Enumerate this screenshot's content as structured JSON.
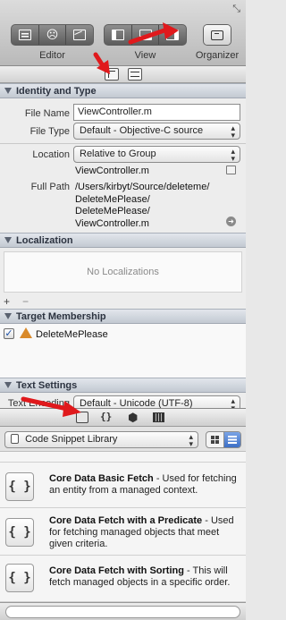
{
  "toolbar": {
    "editor_label": "Editor",
    "view_label": "View",
    "organizer_label": "Organizer"
  },
  "identity": {
    "title": "Identity and Type",
    "file_name_label": "File Name",
    "file_name_value": "ViewController.m",
    "file_type_label": "File Type",
    "file_type_value": "Default - Objective-C source",
    "location_label": "Location",
    "location_value": "Relative to Group",
    "location_file": "ViewController.m",
    "full_path_label": "Full Path",
    "full_path_lines": [
      "/Users/kirbyt/Source/deleteme/",
      "DeleteMePlease/",
      "DeleteMePlease/",
      "ViewController.m"
    ]
  },
  "localization": {
    "title": "Localization",
    "empty_text": "No Localizations",
    "add_label": "+",
    "remove_label": "−"
  },
  "target_membership": {
    "title": "Target Membership",
    "target_name": "DeleteMePlease",
    "checked": true
  },
  "text_settings": {
    "title": "Text Settings",
    "encoding_label": "Text Encoding",
    "encoding_value": "Default - Unicode (UTF-8)"
  },
  "library": {
    "selected": "Code Snippet Library",
    "search_placeholder": "",
    "snippets": [
      {
        "icon": "{ }",
        "title": "Core Data Basic Fetch",
        "desc": " - Used for fetching an entity from a managed context."
      },
      {
        "icon": "{ }",
        "title": "Core Data Fetch with a Predicate",
        "desc": " - Used for fetching managed objects that meet given criteria."
      },
      {
        "icon": "{ }",
        "title": "Core Data Fetch with Sorting",
        "desc": " - This will fetch managed objects in a specific order."
      }
    ]
  },
  "colors": {
    "annotation_arrow": "#e0191c",
    "selection_blue": "#3d7bd9"
  }
}
